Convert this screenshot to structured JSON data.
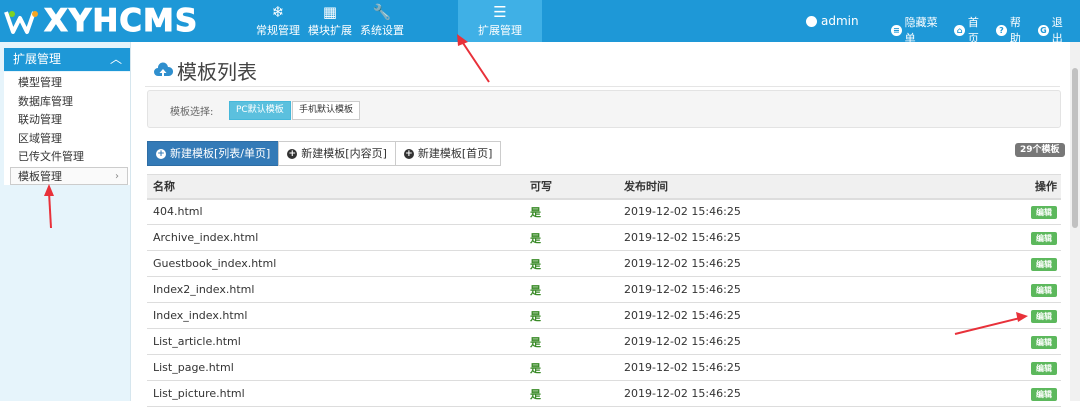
{
  "brand": {
    "text": "XYHCMS"
  },
  "nav": [
    {
      "label": "常规管理",
      "icon": "snowflake-icon"
    },
    {
      "label": "模块扩展",
      "icon": "grid-icon"
    },
    {
      "label": "系统设置",
      "icon": "wrench-icon"
    },
    {
      "label": "扩展管理",
      "icon": "list-icon",
      "active": true
    }
  ],
  "user": {
    "name": "admin"
  },
  "toolbar": {
    "hide_menu": "隐藏菜单",
    "home": "首页",
    "help": "帮助",
    "logout": "退出"
  },
  "sidebar": {
    "title": "扩展管理",
    "items": [
      {
        "label": "模型管理"
      },
      {
        "label": "数据库管理"
      },
      {
        "label": "联动管理"
      },
      {
        "label": "区域管理"
      },
      {
        "label": "已传文件管理"
      },
      {
        "label": "模板管理",
        "active": true
      }
    ]
  },
  "page": {
    "title": "模板列表",
    "select_label": "模板选择:",
    "select_options": [
      "PC默认模板",
      "手机默认模板"
    ],
    "tabs": [
      "新建模板[列表/单页]",
      "新建模板[内容页]",
      "新建模板[首页]"
    ],
    "count_badge": "29个模板"
  },
  "table": {
    "headers": [
      "名称",
      "可写",
      "发布时间",
      "操作"
    ],
    "rows": [
      {
        "name": "404.html",
        "writable": "是",
        "time": "2019-12-02 15:46:25",
        "action": "编辑"
      },
      {
        "name": "Archive_index.html",
        "writable": "是",
        "time": "2019-12-02 15:46:25",
        "action": "编辑"
      },
      {
        "name": "Guestbook_index.html",
        "writable": "是",
        "time": "2019-12-02 15:46:25",
        "action": "编辑"
      },
      {
        "name": "Index2_index.html",
        "writable": "是",
        "time": "2019-12-02 15:46:25",
        "action": "编辑"
      },
      {
        "name": "Index_index.html",
        "writable": "是",
        "time": "2019-12-02 15:46:25",
        "action": "编辑"
      },
      {
        "name": "List_article.html",
        "writable": "是",
        "time": "2019-12-02 15:46:25",
        "action": "编辑"
      },
      {
        "name": "List_page.html",
        "writable": "是",
        "time": "2019-12-02 15:46:25",
        "action": "编辑"
      },
      {
        "name": "List_picture.html",
        "writable": "是",
        "time": "2019-12-02 15:46:25",
        "action": "编辑"
      }
    ]
  },
  "colors": {
    "topbar": "#1e98d7",
    "annotation": "#e8313a",
    "edit": "#5cb85c"
  }
}
